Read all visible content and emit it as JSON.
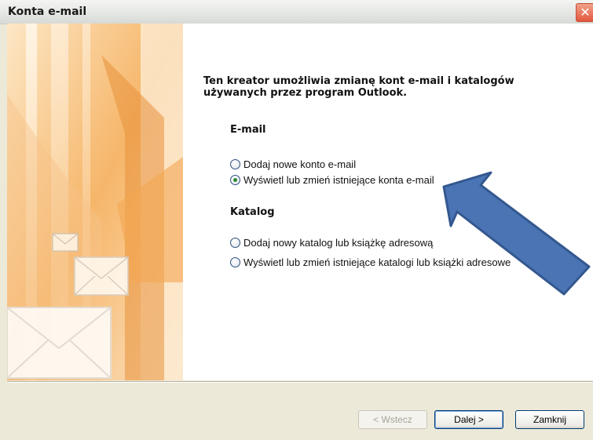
{
  "window": {
    "title": "Konta e-mail"
  },
  "intro": {
    "line1": "Ten kreator umożliwia zmianę kont e-mail i katalogów",
    "line2": "używanych przez program Outlook."
  },
  "email": {
    "label": "E-mail",
    "options": [
      {
        "label": "Dodaj nowe konto e-mail",
        "checked": false
      },
      {
        "label": "Wyświetl lub zmień istniejące konta e-mail",
        "checked": true
      }
    ]
  },
  "directory": {
    "label": "Katalog",
    "options": [
      {
        "label": "Dodaj nowy katalog lub książkę adresową",
        "checked": false
      },
      {
        "label": "Wyświetl lub zmień istniejące katalogi lub książki adresowe",
        "checked": false
      }
    ]
  },
  "buttons": {
    "back": "< Wstecz",
    "next": "Dalej >",
    "close": "Zamknij"
  },
  "colors": {
    "arrow": "#4a74b4",
    "side_art": "#f0a64a"
  }
}
